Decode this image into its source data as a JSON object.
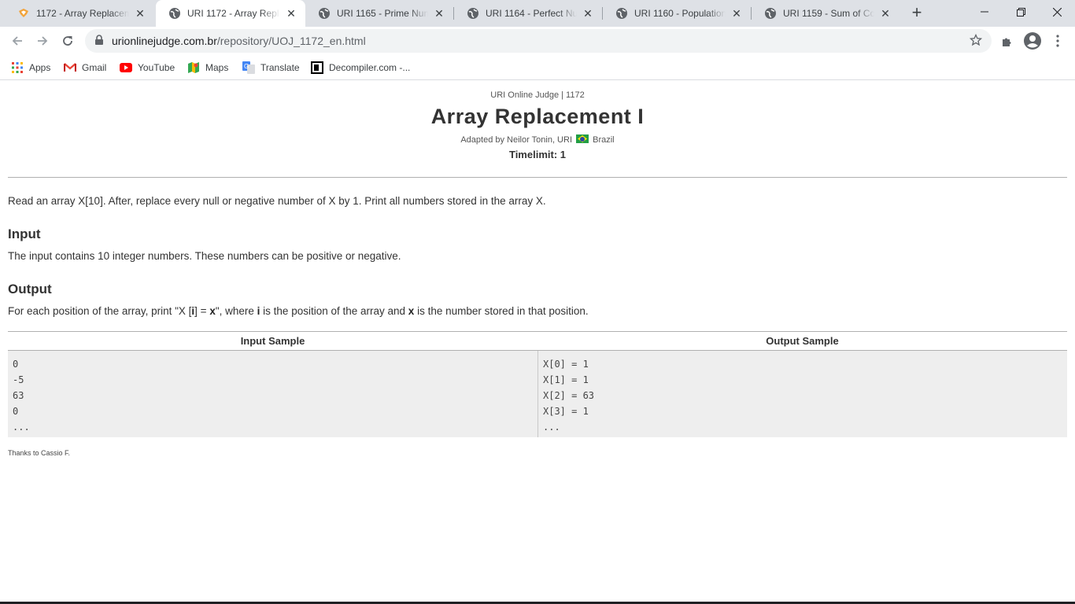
{
  "browser": {
    "tabs": [
      {
        "title": "1172 - Array Replaceme",
        "active": false
      },
      {
        "title": "URI 1172 - Array Replac",
        "active": true
      },
      {
        "title": "URI 1165 - Prime Numb",
        "active": false
      },
      {
        "title": "URI 1164 - Perfect Num",
        "active": false
      },
      {
        "title": "URI 1160 - Population I",
        "active": false
      },
      {
        "title": "URI 1159 - Sum of Cons",
        "active": false
      }
    ],
    "url_domain": "urionlinejudge.com.br",
    "url_path": "/repository/UOJ_1172_en.html",
    "bookmarks": [
      {
        "label": "Apps",
        "icon": "apps-grid-icon"
      },
      {
        "label": "Gmail",
        "icon": "gmail-icon"
      },
      {
        "label": "YouTube",
        "icon": "youtube-icon"
      },
      {
        "label": "Maps",
        "icon": "maps-icon"
      },
      {
        "label": "Translate",
        "icon": "translate-icon"
      },
      {
        "label": "Decompiler.com -...",
        "icon": "decompiler-icon"
      }
    ]
  },
  "problem": {
    "breadcrumb": "URI Online Judge | 1172",
    "title": "Array Replacement I",
    "author_prefix": "Adapted by Neilor Tonin, URI",
    "author_country": "Brazil",
    "timelimit": "Timelimit: 1",
    "description": "Read an array X[10]. After, replace every null or negative number of X by 1. Print all numbers stored in the array X.",
    "input_heading": "Input",
    "input_text": "The input contains 10 integer numbers. These numbers can be positive or negative.",
    "output_heading": "Output",
    "output_text_1": "For each position of the array, print \"X [",
    "output_i": "i",
    "output_text_2": "] = ",
    "output_x": "x",
    "output_text_3": "\", where ",
    "output_i2": "i",
    "output_text_4": " is the position of the array and ",
    "output_x2": "x",
    "output_text_5": " is the number stored in that position.",
    "input_sample_header": "Input Sample",
    "output_sample_header": "Output Sample",
    "input_sample_lines": [
      "0",
      "-5",
      "63",
      "0",
      "..."
    ],
    "output_sample_lines": [
      "X[0] = 1",
      "X[1] = 1",
      "X[2] = 63",
      "X[3] = 1",
      "..."
    ],
    "thanks": "Thanks to Cassio F."
  }
}
